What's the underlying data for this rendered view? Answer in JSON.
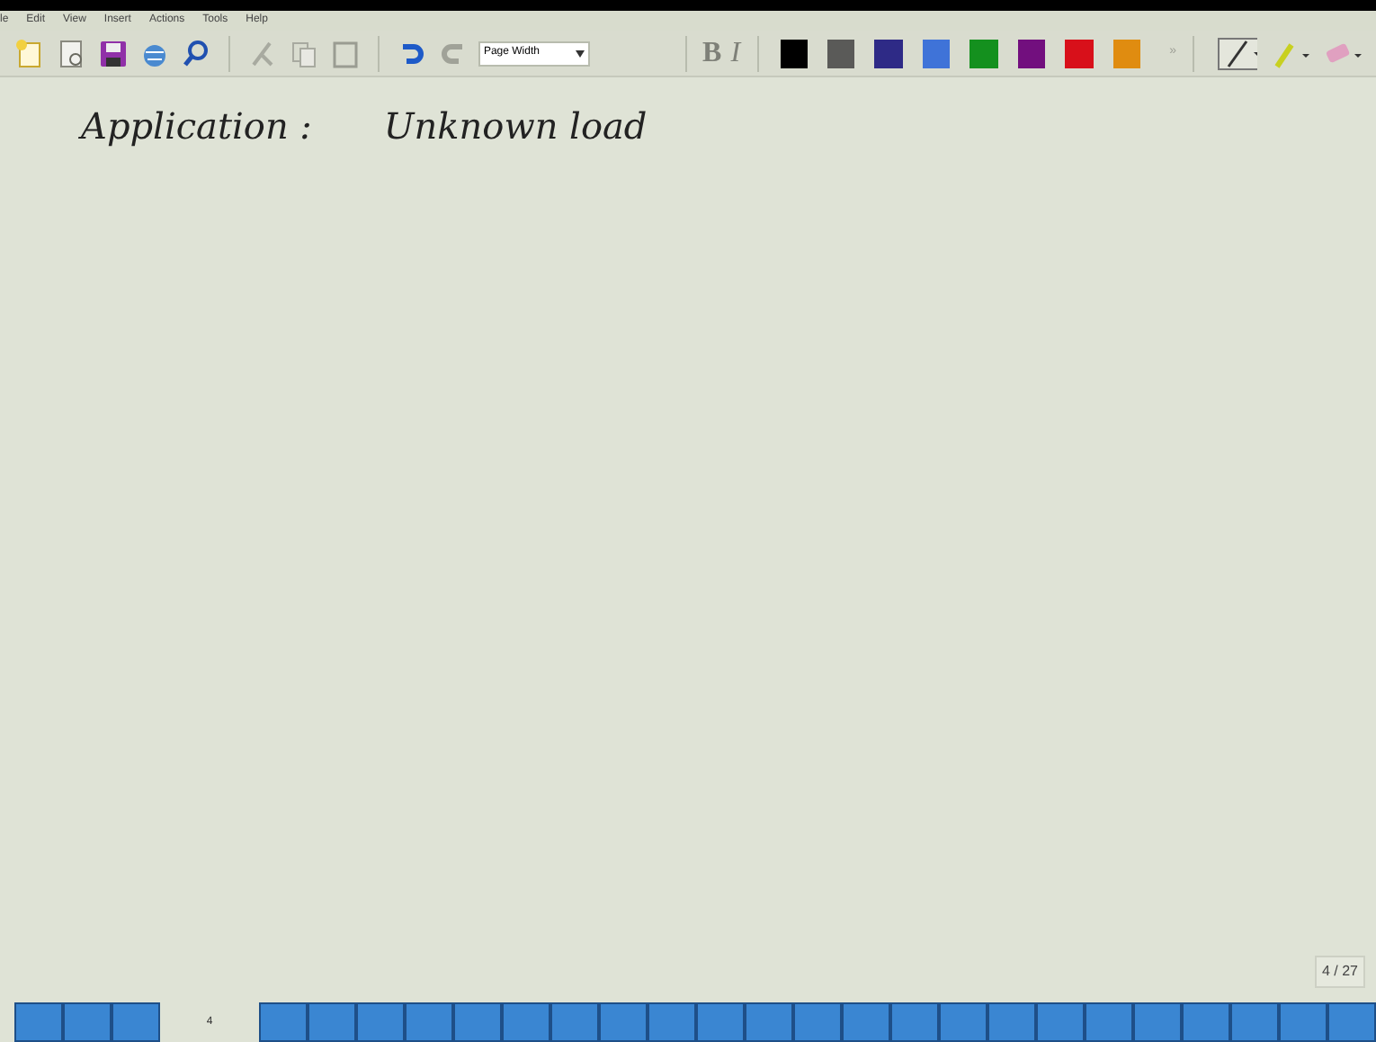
{
  "menu": [
    "le",
    "Edit",
    "View",
    "Insert",
    "Actions",
    "Tools",
    "Help"
  ],
  "toolbar": {
    "zoom": "Page Width",
    "bold": "B",
    "italic": "I",
    "more": "»",
    "colors": [
      {
        "color": "#000000"
      },
      {
        "color": "#5a5a58"
      },
      {
        "color": "#2e2a86"
      },
      {
        "color": "#3f73d8"
      },
      {
        "color": "#14901e"
      },
      {
        "color": "#720f7e"
      },
      {
        "color": "#d8101a"
      },
      {
        "color": "#e08c10"
      }
    ]
  },
  "note": {
    "heading": "Application :",
    "text": "Unknown load"
  },
  "page_indicator": "4 / 27",
  "page_tabs": [
    {
      "selected": false
    },
    {
      "selected": false
    },
    {
      "selected": false
    },
    {
      "selected": true,
      "label": "4"
    },
    {
      "selected": false
    },
    {
      "selected": false
    },
    {
      "selected": false
    },
    {
      "selected": false
    },
    {
      "selected": false
    },
    {
      "selected": false
    },
    {
      "selected": false
    },
    {
      "selected": false
    },
    {
      "selected": false
    },
    {
      "selected": false
    },
    {
      "selected": false
    },
    {
      "selected": false
    },
    {
      "selected": false
    },
    {
      "selected": false
    },
    {
      "selected": false
    },
    {
      "selected": false
    },
    {
      "selected": false
    },
    {
      "selected": false
    },
    {
      "selected": false
    },
    {
      "selected": false
    },
    {
      "selected": false
    },
    {
      "selected": false
    },
    {
      "selected": false
    }
  ]
}
